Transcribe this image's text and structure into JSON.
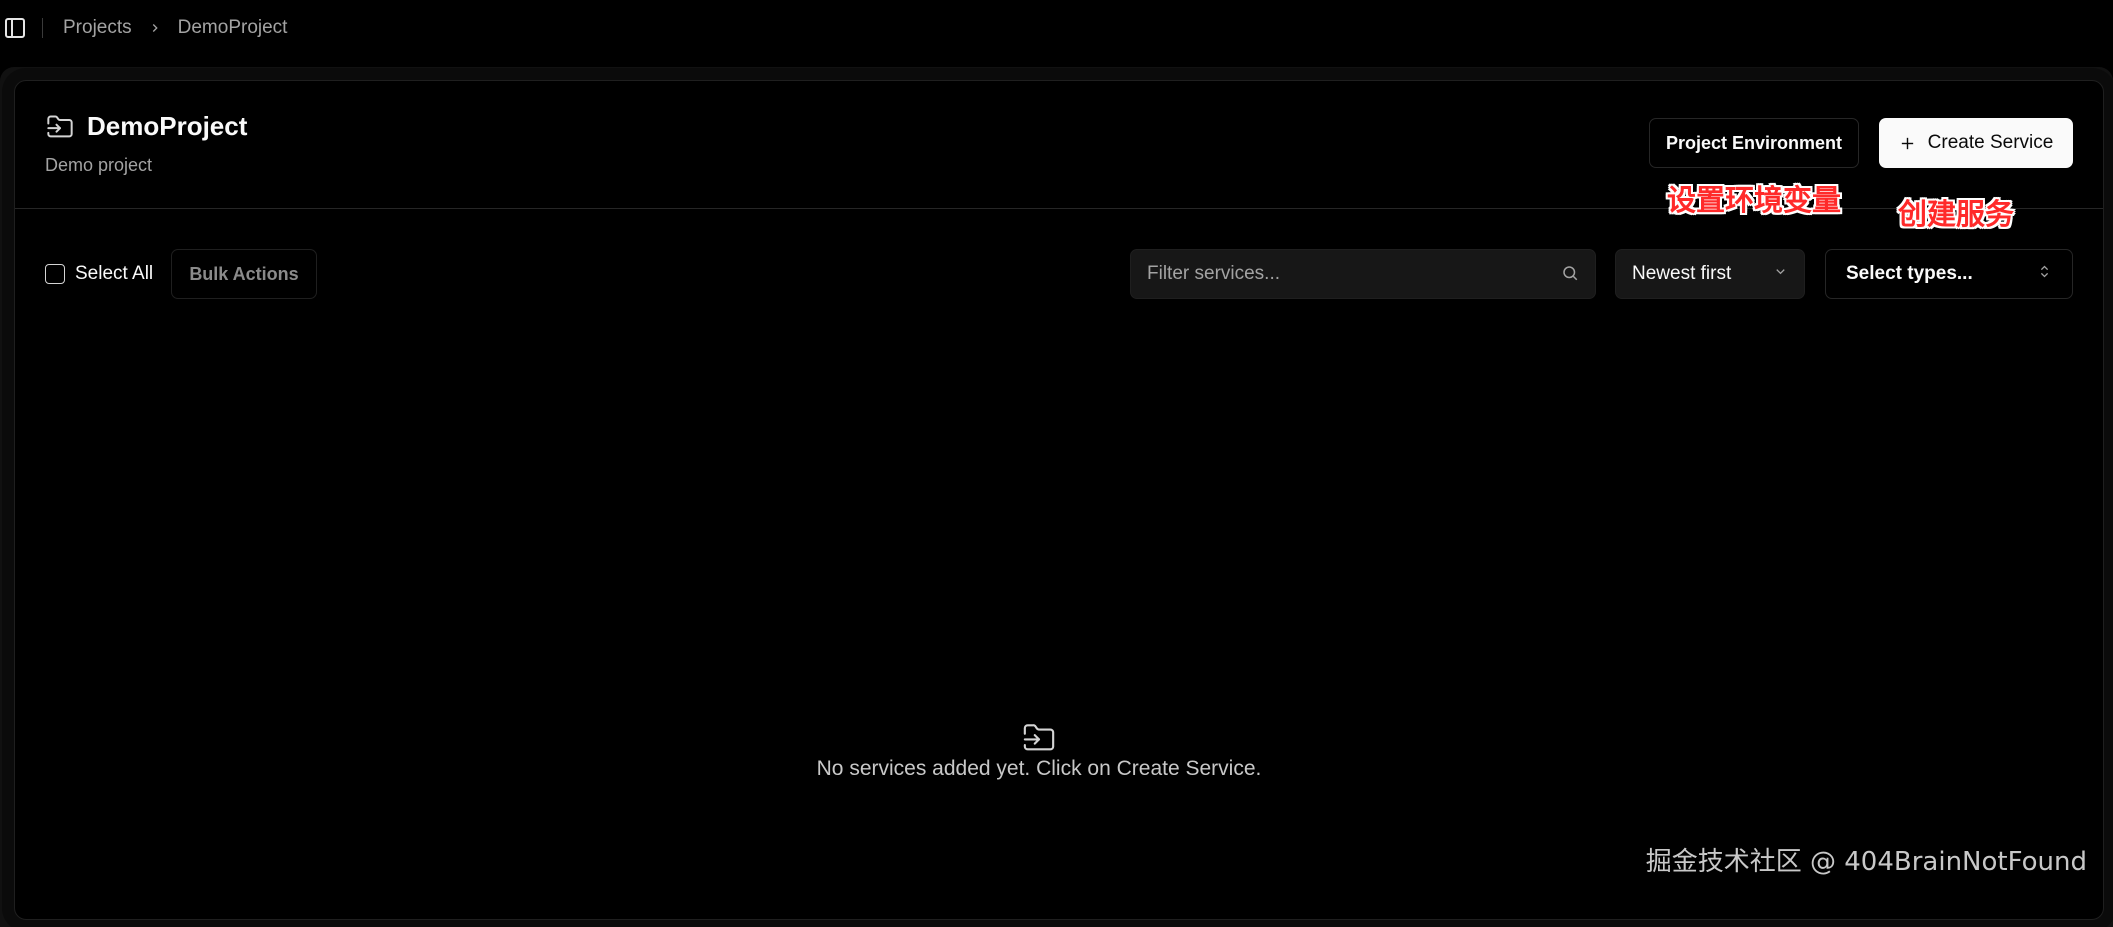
{
  "breadcrumb": {
    "items": [
      "Projects",
      "DemoProject"
    ]
  },
  "project": {
    "title": "DemoProject",
    "subtitle": "Demo project"
  },
  "header_actions": {
    "environment_label": "Project Environment",
    "create_label": "Create Service"
  },
  "annotations": {
    "environment": "设置环境变量",
    "create": "创建服务"
  },
  "toolbar": {
    "select_all_label": "Select All",
    "bulk_actions_label": "Bulk Actions",
    "search_placeholder": "Filter services...",
    "sort_value": "Newest first",
    "types_value": "Select types..."
  },
  "empty_state": {
    "message": "No services added yet. Click on Create Service."
  },
  "watermark": "掘金技术社区 @ 404BrainNotFound",
  "icons": {
    "sidebar_toggle": "sidebar-toggle-icon",
    "breadcrumb_separator": "chevron-right-icon",
    "project": "folder-input-icon",
    "create": "plus-icon",
    "search": "search-icon",
    "sort": "chevron-down-icon",
    "types": "chevrons-up-down-icon",
    "empty": "folder-input-icon"
  },
  "colors": {
    "background": "#000000",
    "primary_button_bg": "#fafafa",
    "annotation": "#ff2a2a",
    "muted_text": "#a3a3a3"
  }
}
